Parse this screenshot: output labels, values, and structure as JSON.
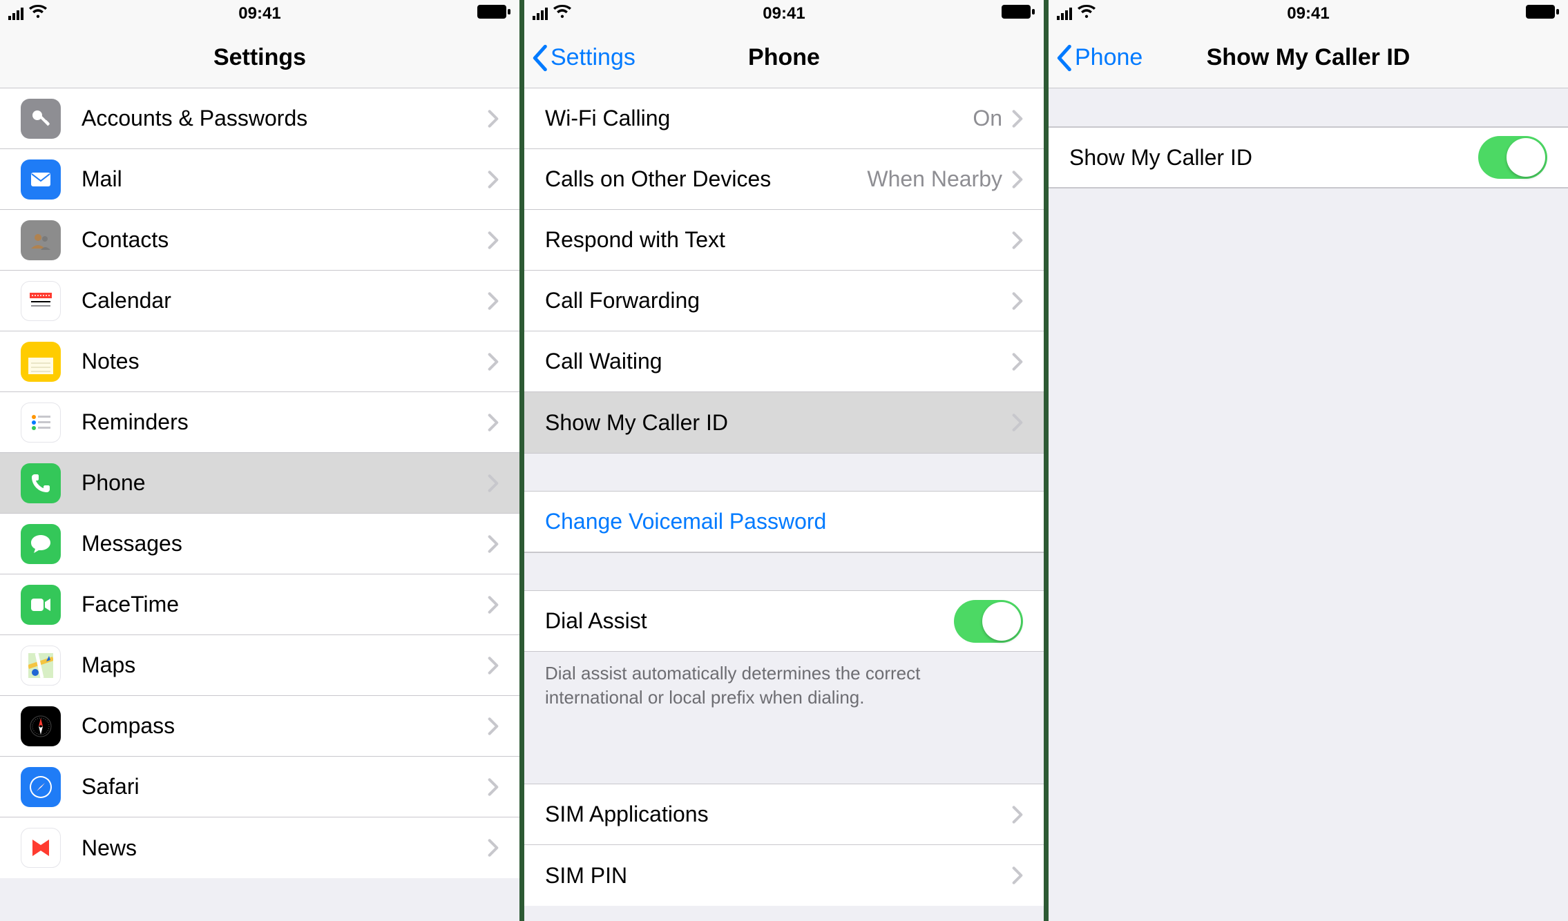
{
  "status": {
    "time": "09:41"
  },
  "screen1": {
    "title": "Settings",
    "items": [
      {
        "label": "Accounts & Passwords",
        "icon": "key-icon",
        "bg": "#8e8e93"
      },
      {
        "label": "Mail",
        "icon": "mail-icon",
        "bg": "#1f7cf6"
      },
      {
        "label": "Contacts",
        "icon": "contacts-icon",
        "bg": "#8c8c8c"
      },
      {
        "label": "Calendar",
        "icon": "calendar-icon",
        "bg": "#ffffff"
      },
      {
        "label": "Notes",
        "icon": "notes-icon",
        "bg": "#ffcc00"
      },
      {
        "label": "Reminders",
        "icon": "reminders-icon",
        "bg": "#ffffff"
      },
      {
        "label": "Phone",
        "icon": "phone-icon",
        "bg": "#34c759",
        "selected": true
      },
      {
        "label": "Messages",
        "icon": "messages-icon",
        "bg": "#34c759"
      },
      {
        "label": "FaceTime",
        "icon": "facetime-icon",
        "bg": "#34c759"
      },
      {
        "label": "Maps",
        "icon": "maps-icon",
        "bg": "#ffffff"
      },
      {
        "label": "Compass",
        "icon": "compass-icon",
        "bg": "#000000"
      },
      {
        "label": "Safari",
        "icon": "safari-icon",
        "bg": "#1f7cf6"
      },
      {
        "label": "News",
        "icon": "news-icon",
        "bg": "#ffffff"
      }
    ]
  },
  "screen2": {
    "back": "Settings",
    "title": "Phone",
    "group1": [
      {
        "label": "Wi-Fi Calling",
        "detail": "On"
      },
      {
        "label": "Calls on Other Devices",
        "detail": "When Nearby"
      },
      {
        "label": "Respond with Text"
      },
      {
        "label": "Call Forwarding"
      },
      {
        "label": "Call Waiting"
      },
      {
        "label": "Show My Caller ID",
        "selected": true
      }
    ],
    "voicemail": "Change Voicemail Password",
    "dial_assist": {
      "label": "Dial Assist",
      "on": true
    },
    "dial_assist_note": "Dial assist automatically determines the correct international or local prefix when dialing.",
    "group_sim": [
      {
        "label": "SIM Applications"
      },
      {
        "label": "SIM PIN"
      }
    ]
  },
  "screen3": {
    "back": "Phone",
    "title": "Show My Caller ID",
    "toggle": {
      "label": "Show My Caller ID",
      "on": true
    }
  }
}
